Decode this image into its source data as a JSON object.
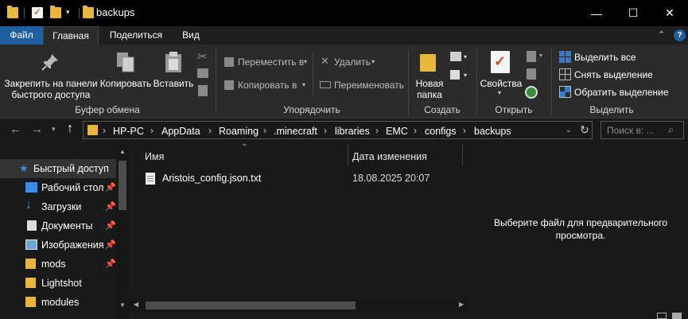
{
  "window": {
    "title": "backups",
    "minimize_glyph": "—",
    "maximize_glyph": "☐",
    "close_glyph": "✕"
  },
  "ribbon_tabs": [
    {
      "label": "Файл"
    },
    {
      "label": "Главная"
    },
    {
      "label": "Поделиться"
    },
    {
      "label": "Вид"
    }
  ],
  "ribbon": {
    "clipboard": {
      "pin_label_1": "Закрепить на панели",
      "pin_label_2": "быстрого доступа",
      "copy_label": "Копировать",
      "paste_label": "Вставить",
      "group_label": "Буфер обмена"
    },
    "organize": {
      "move_label": "Переместить в",
      "copy_to_label": "Копировать в",
      "delete_label": "Удалить",
      "rename_label": "Переименовать",
      "group_label": "Упорядочить"
    },
    "new": {
      "new_folder_1": "Новая",
      "new_folder_2": "папка",
      "group_label": "Создать"
    },
    "open": {
      "properties_label": "Свойства",
      "group_label": "Открыть"
    },
    "select": {
      "select_all": "Выделить все",
      "select_none": "Снять выделение",
      "invert": "Обратить выделение",
      "group_label": "Выделить"
    }
  },
  "address": {
    "crumbs": [
      "HP-PC",
      "AppData",
      "Roaming",
      ".minecraft",
      "libraries",
      "EMC",
      "configs",
      "backups"
    ],
    "search_placeholder": "Поиск в: ..."
  },
  "nav_pane": {
    "quick_access": "Быстрый доступ",
    "items": [
      {
        "label": "Рабочий стол",
        "pinned": true,
        "icon": "desktop-icon"
      },
      {
        "label": "Загрузки",
        "pinned": true,
        "icon": "download-icon"
      },
      {
        "label": "Документы",
        "pinned": true,
        "icon": "documents-icon"
      },
      {
        "label": "Изображения",
        "pinned": true,
        "icon": "pictures-icon"
      },
      {
        "label": "mods",
        "pinned": true,
        "icon": "folder-icon"
      },
      {
        "label": "Lightshot",
        "pinned": false,
        "icon": "folder-icon"
      },
      {
        "label": "modules",
        "pinned": false,
        "icon": "folder-icon"
      }
    ]
  },
  "file_list": {
    "columns": {
      "name": "Имя",
      "date": "Дата изменения"
    },
    "files": [
      {
        "name": "Aristois_config.json.txt",
        "date": "18.08.2025 20:07"
      }
    ]
  },
  "preview": {
    "text_1": "Выберите файл для предварительного",
    "text_2": "просмотра."
  },
  "colors": {
    "accent": "#1e5fa0",
    "folder": "#e8b83a",
    "background": "#191919",
    "ribbon": "#2b2b2b"
  }
}
